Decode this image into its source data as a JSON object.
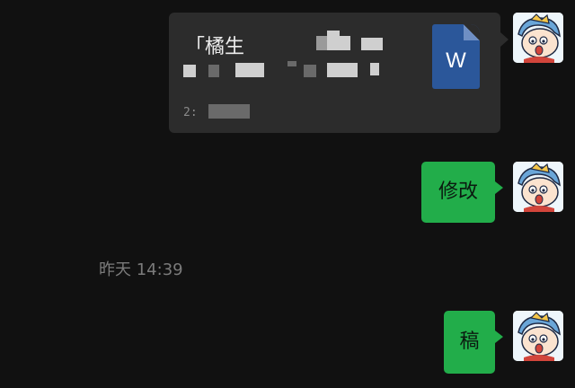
{
  "messages": [
    {
      "type": "file",
      "title": "「橘生",
      "file_icon": "word-document-icon",
      "file_icon_letter": "W",
      "source_label": "2:"
    },
    {
      "type": "text",
      "text": "修改"
    },
    {
      "type": "timestamp",
      "text": "昨天 14:39"
    },
    {
      "type": "text",
      "text": "稿"
    }
  ],
  "colors": {
    "background": "#111111",
    "file_card": "#2c2c2c",
    "bubble_green": "#22ad4a",
    "word_blue": "#2b579a",
    "timestamp_gray": "#7b7b7b"
  },
  "avatar": {
    "icon": "cartoon-boy-avatar-icon"
  }
}
